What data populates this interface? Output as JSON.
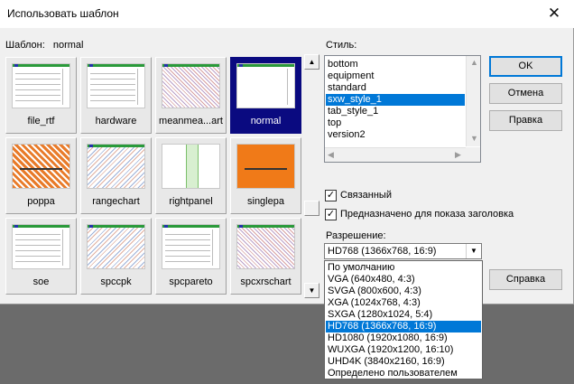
{
  "window": {
    "title": "Использовать шаблон",
    "close_glyph": "✕"
  },
  "template": {
    "label": "Шаблон:",
    "value": "normal"
  },
  "templates": [
    {
      "name": "file_rtf",
      "thumb": "lines"
    },
    {
      "name": "hardware",
      "thumb": "lines"
    },
    {
      "name": "meanmea...art",
      "thumb": "noise"
    },
    {
      "name": "normal",
      "thumb": "blank",
      "selected": true
    },
    {
      "name": "poppa",
      "thumb": "stripes"
    },
    {
      "name": "rangechart",
      "thumb": "noise2"
    },
    {
      "name": "rightpanel",
      "thumb": "rpanel"
    },
    {
      "name": "singlepa",
      "thumb": "orange"
    },
    {
      "name": "soe",
      "thumb": "lines"
    },
    {
      "name": "spccpk",
      "thumb": "noise2"
    },
    {
      "name": "spcpareto",
      "thumb": "lines"
    },
    {
      "name": "spcxrschart",
      "thumb": "noise"
    }
  ],
  "scroll": {
    "up": "▲",
    "down": "▼"
  },
  "styles": {
    "label": "Стиль:",
    "items": [
      "bottom",
      "equipment",
      "standard",
      "sxw_style_1",
      "tab_style_1",
      "top",
      "version2"
    ],
    "selected": "sxw_style_1"
  },
  "checkboxes": [
    {
      "label": "Связанный",
      "checked": true,
      "mark": "✓"
    },
    {
      "label": "Предназначено для показа заголовка",
      "checked": true,
      "mark": "✓"
    }
  ],
  "resolution": {
    "label": "Разрешение:",
    "value": "HD768 (1366x768, 16:9)",
    "arrow": "▼",
    "options": [
      "По умолчанию",
      "VGA (640x480, 4:3)",
      "SVGA (800x600, 4:3)",
      "XGA (1024x768, 4:3)",
      "SXGA (1280x1024, 5:4)",
      "HD768 (1366x768, 16:9)",
      "HD1080 (1920x1080, 16:9)",
      "WUXGA (1920x1200, 16:10)",
      "UHD4K (3840x2160, 16:9)",
      "Определено пользователем"
    ],
    "selected": "HD768 (1366x768, 16:9)"
  },
  "buttons": {
    "ok": "OK",
    "cancel": "Отмена",
    "edit": "Правка",
    "help": "Справка"
  },
  "colors": {
    "selection": "#0078d7",
    "selected_tile": "#0a0a80"
  }
}
